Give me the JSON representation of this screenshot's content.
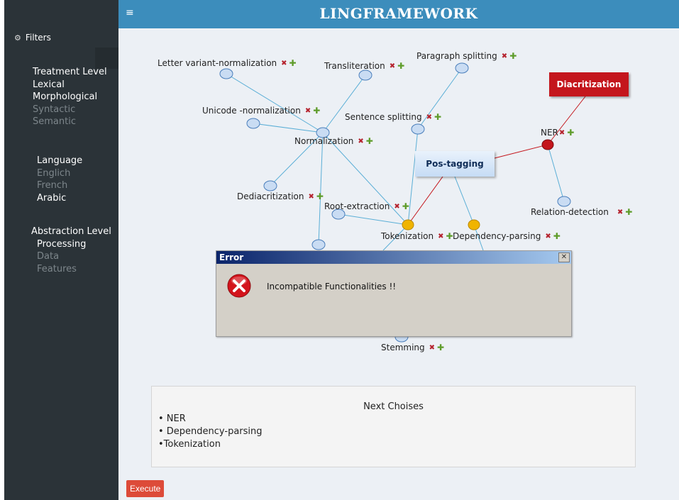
{
  "app": {
    "title": "LINGFRAMEWORK",
    "menu_icon": "≡"
  },
  "sidebar": {
    "filters_label": "Filters",
    "treatment": {
      "heading": "Treatment Level",
      "items": [
        {
          "label": "Lexical",
          "active": true
        },
        {
          "label": "Morphological",
          "active": true
        },
        {
          "label": "Syntactic",
          "active": false
        },
        {
          "label": "Semantic",
          "active": false
        }
      ]
    },
    "language": {
      "heading": "Language",
      "items": [
        {
          "label": "Englich",
          "active": false
        },
        {
          "label": "French",
          "active": false
        },
        {
          "label": "Arabic",
          "active": true
        }
      ]
    },
    "abstraction": {
      "heading": "Abstraction Level",
      "items": [
        {
          "label": "Processing",
          "active": true
        },
        {
          "label": "Data",
          "active": false
        },
        {
          "label": "Features",
          "active": false
        }
      ]
    }
  },
  "graph": {
    "labels": {
      "letter_variant": "Letter variant-normalization",
      "transliteration": "Transliteration",
      "paragraph": "Paragraph splitting",
      "unicode": "Unicode -normalization",
      "sentence": "Sentence splitting",
      "normalization": "Normalization",
      "ner": "NER",
      "dediacritization": "Dediacritization",
      "root": "Root-extraction",
      "tokenization": "Tokenization",
      "dependency": "Dependency-parsing",
      "relation": "Relation-detection",
      "stemming": "Stemming"
    },
    "boxes": {
      "diacritization": "Diacritization",
      "pos_tagging": "Pos-tagging"
    },
    "remove_icon": "✖",
    "add_icon": "✚"
  },
  "dialog": {
    "title": "Error",
    "message": "Incompatible Functionalities !!",
    "close": "✕"
  },
  "next": {
    "title": "Next Choises",
    "items": [
      "• NER",
      "• Dependency-parsing",
      "•Tokenization"
    ]
  },
  "execute_label": "Execute",
  "colors": {
    "topbar": "#3c8dbc",
    "sidebar": "#2b3338",
    "selected_node": "#f0b400",
    "active_node": "#c4161c",
    "execute": "#dd4b39"
  }
}
